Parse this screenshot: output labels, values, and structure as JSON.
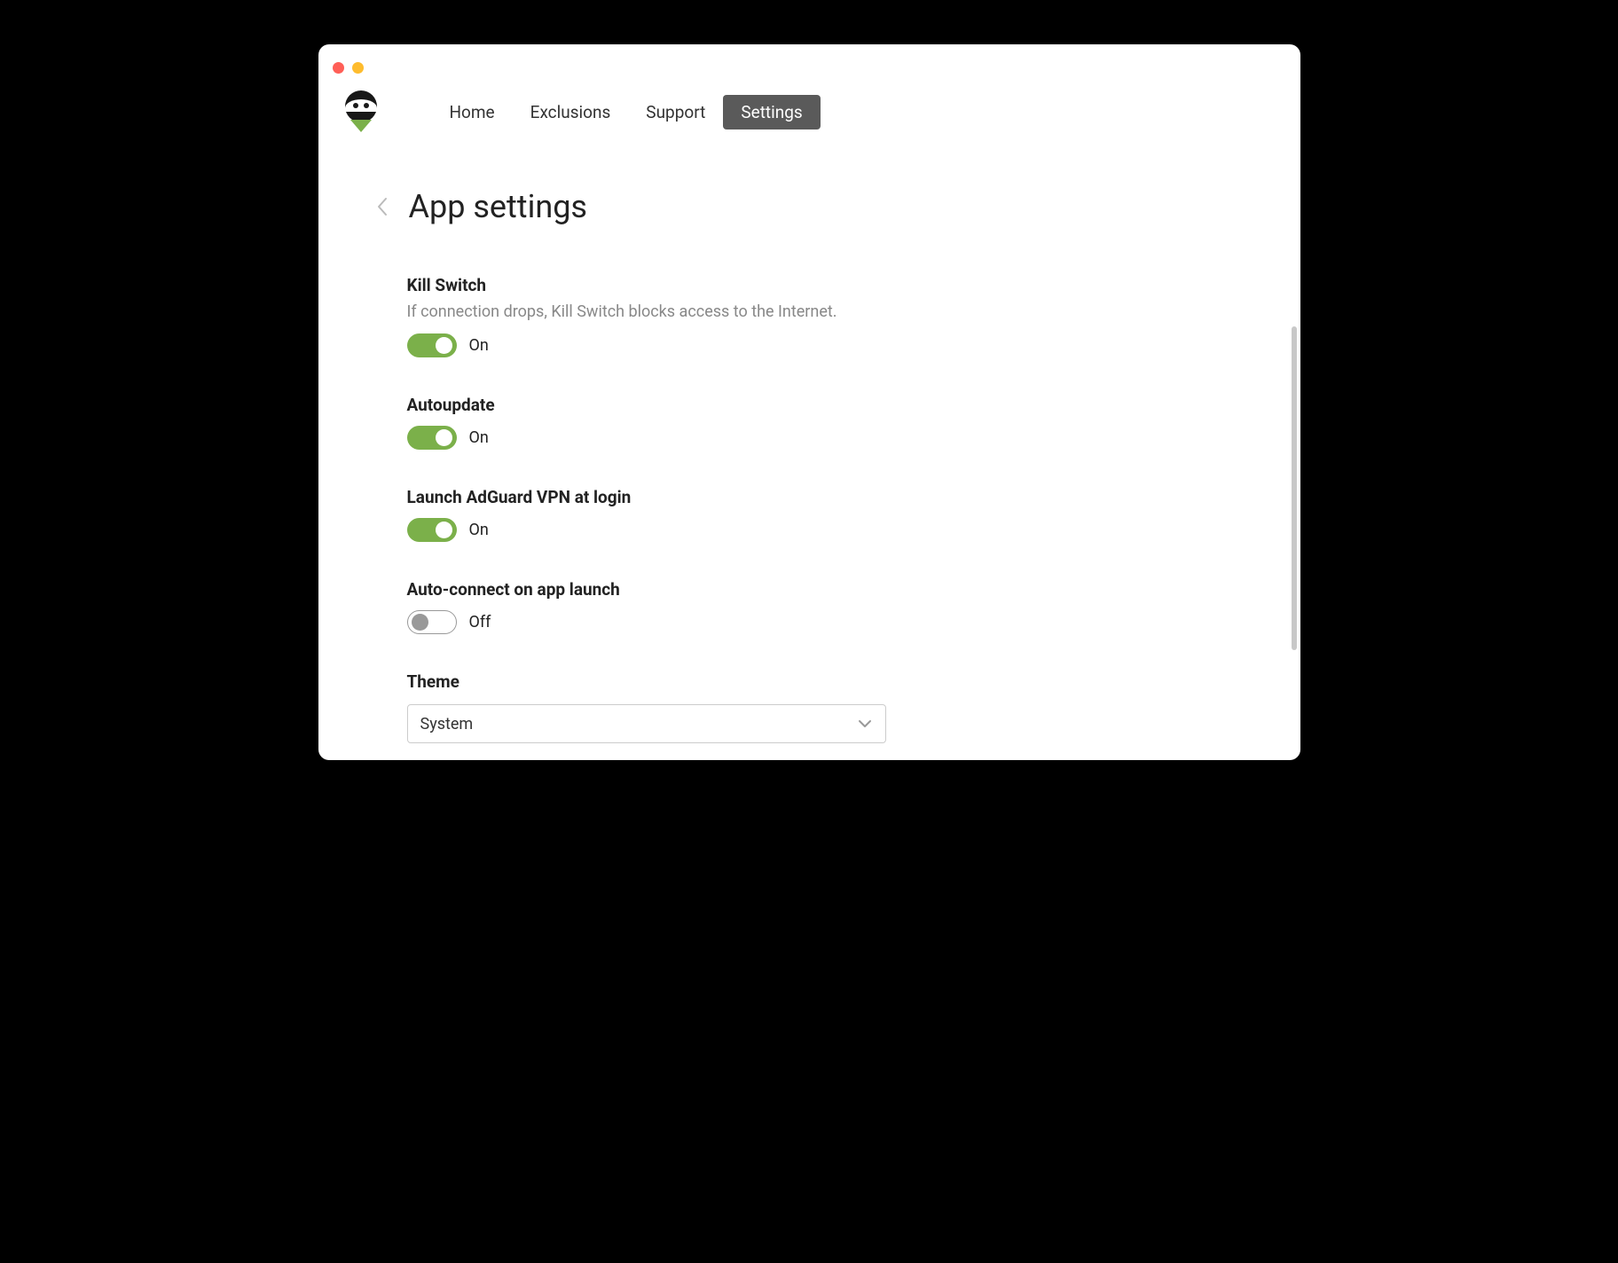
{
  "nav": {
    "items": [
      {
        "label": "Home",
        "active": false
      },
      {
        "label": "Exclusions",
        "active": false
      },
      {
        "label": "Support",
        "active": false
      },
      {
        "label": "Settings",
        "active": true
      }
    ]
  },
  "page": {
    "title": "App settings"
  },
  "settings": {
    "kill_switch": {
      "title": "Kill Switch",
      "desc": "If connection drops, Kill Switch blocks access to the Internet.",
      "state": "On"
    },
    "autoupdate": {
      "title": "Autoupdate",
      "state": "On"
    },
    "launch_at_login": {
      "title": "Launch AdGuard VPN at login",
      "state": "On"
    },
    "auto_connect": {
      "title": "Auto-connect on app launch",
      "state": "Off"
    },
    "theme": {
      "title": "Theme",
      "selected": "System"
    }
  },
  "labels": {
    "on": "On",
    "off": "Off"
  }
}
